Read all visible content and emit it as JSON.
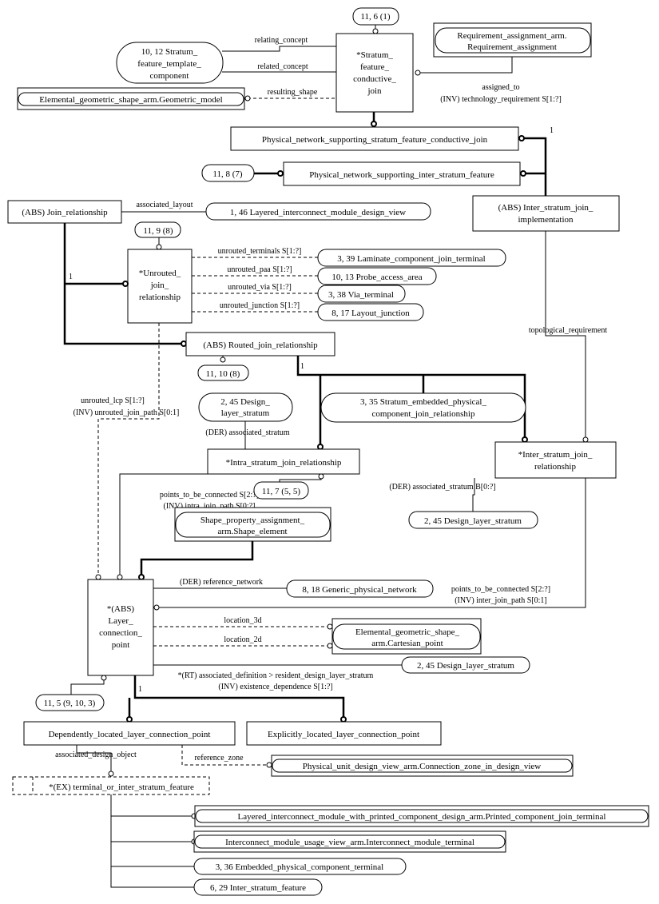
{
  "entities": {
    "stratum_feature_conductive_join": [
      "*Stratum_",
      "feature_",
      "conductive_",
      "join"
    ],
    "sfcj_page_ref": "11, 6 (1)",
    "stratum_feature_template_component": [
      "10, 12 Stratum_",
      "feature_template_",
      "component"
    ],
    "requirement_assignment": [
      "Requirement_assignment_arm.",
      "Requirement_assignment"
    ],
    "geometric_model": "Elemental_geometric_shape_arm.Geometric_model",
    "pn_supporting_sfcj": "Physical_network_supporting_stratum_feature_conductive_join",
    "pn_supporting_isf": "Physical_network_supporting_inter_stratum_feature",
    "pn_isf_page_ref": "11, 8 (7)",
    "join_relationship": "(ABS) Join_relationship",
    "layered_interconnect_module_design_view": "1, 46 Layered_interconnect_module_design_view",
    "inter_stratum_join_implementation": [
      "(ABS) Inter_stratum_join_",
      "implementation"
    ],
    "unrouted_page_ref": "11, 9 (8)",
    "unrouted_join_relationship": [
      "*Unrouted_",
      "join_",
      "relationship"
    ],
    "laminate_component_join_terminal": "3, 39 Laminate_component_join_terminal",
    "probe_access_area": "10, 13 Probe_access_area",
    "via_terminal": "3, 38 Via_terminal",
    "layout_junction": "8, 17 Layout_junction",
    "routed_join_relationship": "(ABS) Routed_join_relationship",
    "routed_page_ref": "11, 10 (8)",
    "design_layer_stratum_a": [
      "2, 45 Design_",
      "layer_stratum"
    ],
    "stratum_embedded": [
      "3, 35 Stratum_embedded_physical_",
      "component_join_relationship"
    ],
    "intra_stratum_join_relationship": "*Intra_stratum_join_relationship",
    "inter_stratum_join_relationship": [
      "*Inter_stratum_join_",
      "relationship"
    ],
    "intra_page_ref": "11, 7 (5, 5)",
    "shape_element": [
      "Shape_property_assignment_",
      "arm.Shape_element"
    ],
    "design_layer_stratum_b": "2, 45 Design_layer_stratum",
    "layer_connection_point": [
      "*(ABS)",
      "Layer_",
      "connection_",
      "point"
    ],
    "generic_physical_network": "8, 18 Generic_physical_network",
    "cartesian_point": [
      "Elemental_geometric_shape_",
      "arm.Cartesian_point"
    ],
    "design_layer_stratum_c": "2, 45 Design_layer_stratum",
    "lcp_page_ref": "11, 5 (9, 10, 3)",
    "dependently_located": "Dependently_located_layer_connection_point",
    "explicitly_located": "Explicitly_located_layer_connection_point",
    "connection_zone": "Physical_unit_design_view_arm.Connection_zone_in_design_view",
    "terminal_or_isf": "*(EX) terminal_or_inter_stratum_feature",
    "printed_component_join_terminal": "Layered_interconnect_module_with_printed_component_design_arm.Printed_component_join_terminal",
    "interconnect_module_terminal": "Interconnect_module_usage_view_arm.Interconnect_module_terminal",
    "embedded_physical_component_terminal": "3, 36 Embedded_physical_component_terminal",
    "inter_stratum_feature": "6, 29 Inter_stratum_feature"
  },
  "labels": {
    "relating_concept": "relating_concept",
    "related_concept": "related_concept",
    "resulting_shape": "resulting_shape",
    "assigned_to": "assigned_to",
    "technology_requirement": "(INV) technology_requirement S[1:?]",
    "one_a": "1",
    "associated_layout": "associated_layout",
    "unrouted_terminals": "unrouted_terminals S[1:?]",
    "unrouted_paa": "unrouted_paa S[1:?]",
    "unrouted_via": "unrouted_via S[1:?]",
    "unrouted_junction": "unrouted_junction S[1:?]",
    "one_b": "1",
    "topological_requirement": "topological_requirement",
    "one_c": "1",
    "unrouted_lcp": "unrouted_lcp S[1:?]",
    "unrouted_join_path": "(INV) unrouted_join_path S[0:1]",
    "der_associated_stratum": "(DER) associated_stratum",
    "der_associated_stratum_b": "(DER) associated_stratum B[0:?]",
    "points_to_be_connected_intra": "points_to_be_connected S[2:?]",
    "intra_join_path": "(INV) intra_join_path S[0:?]",
    "der_reference_network": "(DER) reference_network",
    "points_to_be_connected_inter": "points_to_be_connected S[2:?]",
    "inter_join_path": "(INV) inter_join_path S[0:1]",
    "location_3d": "location_3d",
    "location_2d": "location_2d",
    "rt_associated_definition": "*(RT) associated_definition > resident_design_layer_stratum",
    "existence_dependence": "(INV) existence_dependence S[1:?]",
    "one_d": "1",
    "associated_design_object": "associated_design_object",
    "reference_zone": "reference_zone"
  }
}
